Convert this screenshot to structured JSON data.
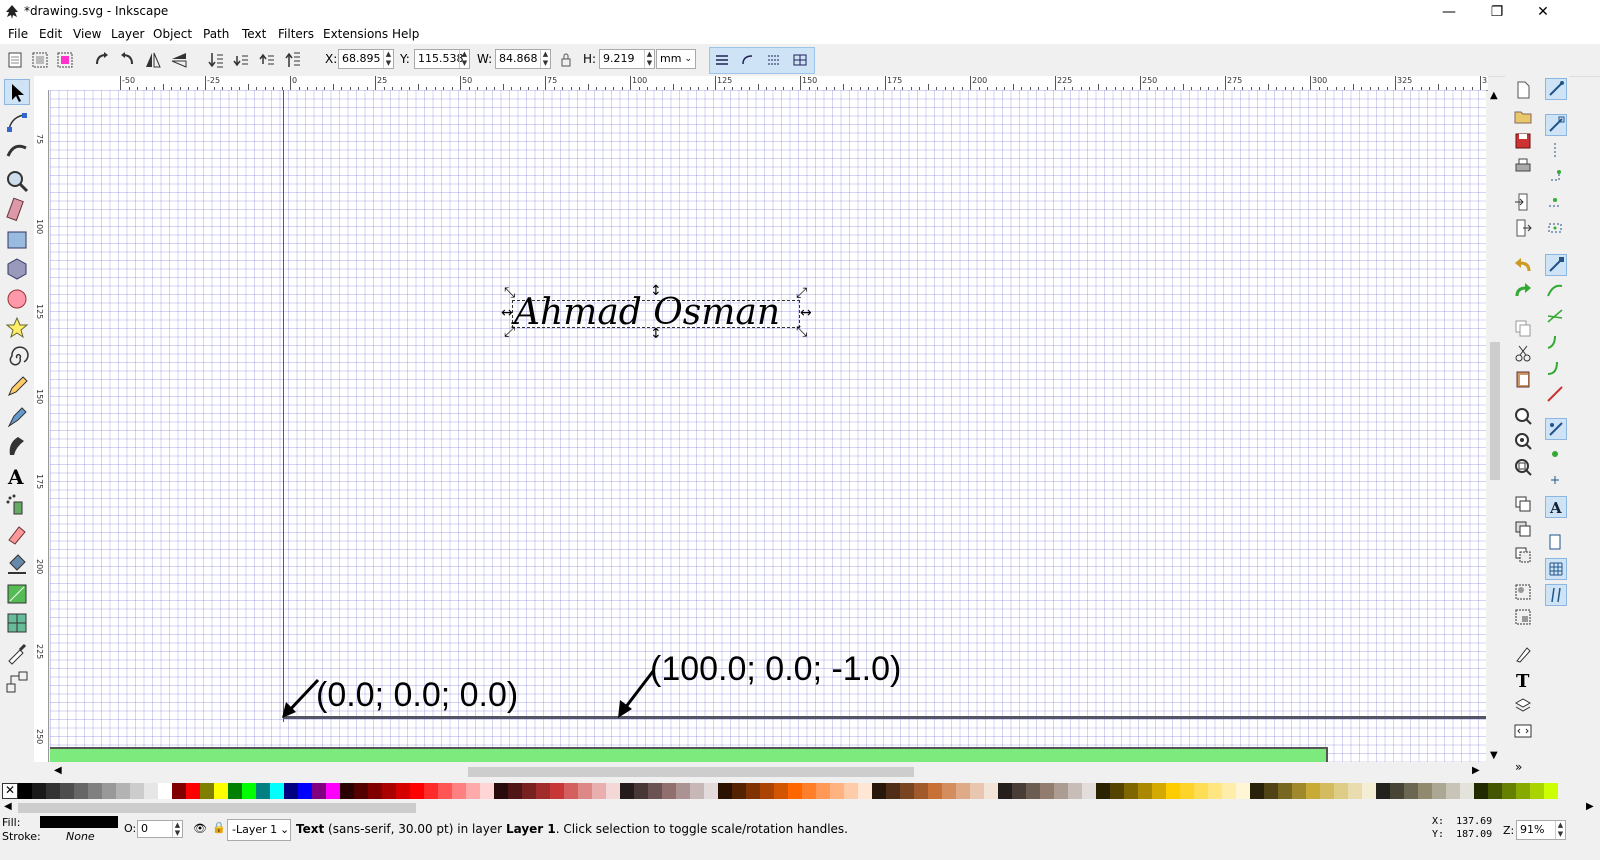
{
  "window": {
    "title": "*drawing.svg - Inkscape",
    "minimize": "—",
    "maximize": "❐",
    "close": "✕"
  },
  "menu": [
    "File",
    "Edit",
    "View",
    "Layer",
    "Object",
    "Path",
    "Text",
    "Filters",
    "Extensions",
    "Help"
  ],
  "controls": {
    "x_label": "X:",
    "x_value": "68.895",
    "y_label": "Y:",
    "y_value": "115.538",
    "w_label": "W:",
    "w_value": "84.868",
    "h_label": "H:",
    "h_value": "9.219",
    "unit": "mm"
  },
  "ruler": {
    "h_ticks": [
      "-50",
      "-25",
      "0",
      "25",
      "50",
      "75",
      "100",
      "125",
      "150",
      "175",
      "200",
      "225",
      "250",
      "275",
      "300",
      "325",
      "350"
    ],
    "v_ticks": [
      "75",
      "100",
      "125",
      "150",
      "175",
      "200",
      "225",
      "250"
    ]
  },
  "canvas": {
    "signature_text": "Ahmad Osman",
    "label_origin": "(0.0; 0.0; 0.0)",
    "label_point": "(100.0; 0.0; -1.0)"
  },
  "palette": [
    "#000000",
    "#1a1a1a",
    "#333333",
    "#4d4d4d",
    "#666666",
    "#808080",
    "#999999",
    "#b3b3b3",
    "#cccccc",
    "#e6e6e6",
    "#ffffff",
    "#800000",
    "#ff0000",
    "#808000",
    "#ffff00",
    "#008000",
    "#00ff00",
    "#008080",
    "#00ffff",
    "#000080",
    "#0000ff",
    "#800080",
    "#ff00ff",
    "#2b0000",
    "#550000",
    "#800000",
    "#aa0000",
    "#d40000",
    "#ff0000",
    "#ff2a2a",
    "#ff5555",
    "#ff8080",
    "#ffaaaa",
    "#ffd5d5",
    "#280b0b",
    "#501616",
    "#782121",
    "#a02c2c",
    "#c83737",
    "#d35f5f",
    "#de8787",
    "#e9afaf",
    "#f4d7d7",
    "#241c1c",
    "#483737",
    "#6c5353",
    "#916f6f",
    "#ac9393",
    "#c8b7b7",
    "#e3dbdb",
    "#2b1100",
    "#552200",
    "#803300",
    "#aa4400",
    "#d45500",
    "#ff6600",
    "#ff7f2a",
    "#ff9955",
    "#ffb380",
    "#ffccaa",
    "#ffe6d5",
    "#28170b",
    "#502d16",
    "#784421",
    "#a05a2c",
    "#c87137",
    "#d38d5f",
    "#deaa87",
    "#e9c6af",
    "#f4e3d7",
    "#241f1c",
    "#483e37",
    "#6c5d53",
    "#917c6f",
    "#ac9d93",
    "#c8beb7",
    "#e3dedb",
    "#2b2200",
    "#554400",
    "#806600",
    "#aa8800",
    "#d4aa00",
    "#ffcc00",
    "#ffd42a",
    "#ffdd55",
    "#ffe680",
    "#ffeeaa",
    "#fff6d5",
    "#28220b",
    "#504416",
    "#786721",
    "#a0892c",
    "#c8ab37",
    "#d3bc5f",
    "#decd87",
    "#e9ddaf",
    "#f4eed7",
    "#24221c",
    "#484537",
    "#6c6753",
    "#918a6f",
    "#aca793",
    "#c8c4b7",
    "#e3e2db",
    "#222b00",
    "#445500",
    "#668000",
    "#88aa00",
    "#aad400",
    "#ccff00"
  ],
  "status": {
    "fill_label": "Fill:",
    "stroke_label": "Stroke:",
    "stroke_value": "None",
    "fill_color": "#000000",
    "opacity_label": "O:",
    "opacity_value": "0",
    "layer": "-Layer 1",
    "msg_bold": "Text",
    "msg_rest": " (sans-serif, 30.00 pt) in layer ",
    "msg_layer": "Layer 1",
    "msg_tail": ". Click selection to toggle scale/rotation handles.",
    "cursor_x": "X:  137.69",
    "cursor_y": "Y:  187.09",
    "zoom_label": "Z:",
    "zoom_value": "91%"
  }
}
